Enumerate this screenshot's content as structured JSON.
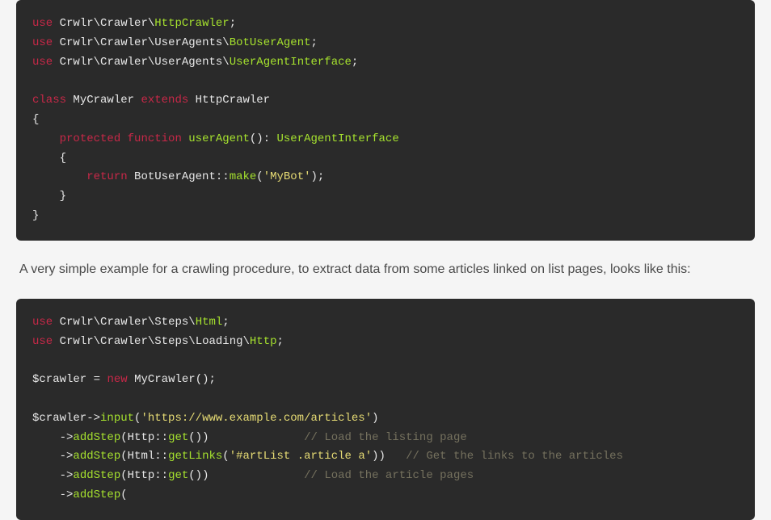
{
  "code1": {
    "l1_use": "use",
    "l1_ns1": "Crwlr",
    "l1_ns2": "Crawler",
    "l1_cls": "HttpCrawler",
    "l2_use": "use",
    "l2_ns1": "Crwlr",
    "l2_ns2": "Crawler",
    "l2_ns3": "UserAgents",
    "l2_cls": "BotUserAgent",
    "l3_use": "use",
    "l3_ns1": "Crwlr",
    "l3_ns2": "Crawler",
    "l3_ns3": "UserAgents",
    "l3_cls": "UserAgentInterface",
    "l4_class": "class",
    "l4_name": "MyCrawler",
    "l4_extends": "extends",
    "l4_parent": "HttpCrawler",
    "l5_protected": "protected",
    "l5_function": "function",
    "l5_fname": "userAgent",
    "l5_ret": "UserAgentInterface",
    "l6_return": "return",
    "l6_cls": "BotUserAgent",
    "l6_method": "make",
    "l6_str": "'MyBot'"
  },
  "paragraph": "A very simple example for a crawling procedure, to extract data from some articles linked on list pages, looks like this:",
  "code2": {
    "l1_use": "use",
    "l1_ns1": "Crwlr",
    "l1_ns2": "Crawler",
    "l1_ns3": "Steps",
    "l1_cls": "Html",
    "l2_use": "use",
    "l2_ns1": "Crwlr",
    "l2_ns2": "Crawler",
    "l2_ns3": "Steps",
    "l2_ns4": "Loading",
    "l2_cls": "Http",
    "l3_var": "$crawler",
    "l3_new": "new",
    "l3_cls": "MyCrawler",
    "l4_var": "$crawler",
    "l4_method": "input",
    "l4_str": "'https://www.example.com/articles'",
    "l5_method": "addStep",
    "l5_cls": "Http",
    "l5_static": "get",
    "l5_comment": "// Load the listing page",
    "l6_method": "addStep",
    "l6_cls": "Html",
    "l6_static": "getLinks",
    "l6_str": "'#artList .article a'",
    "l6_comment": "// Get the links to the articles",
    "l7_method": "addStep",
    "l7_cls": "Http",
    "l7_static": "get",
    "l7_comment": "// Load the article pages",
    "l8_method": "addStep"
  }
}
